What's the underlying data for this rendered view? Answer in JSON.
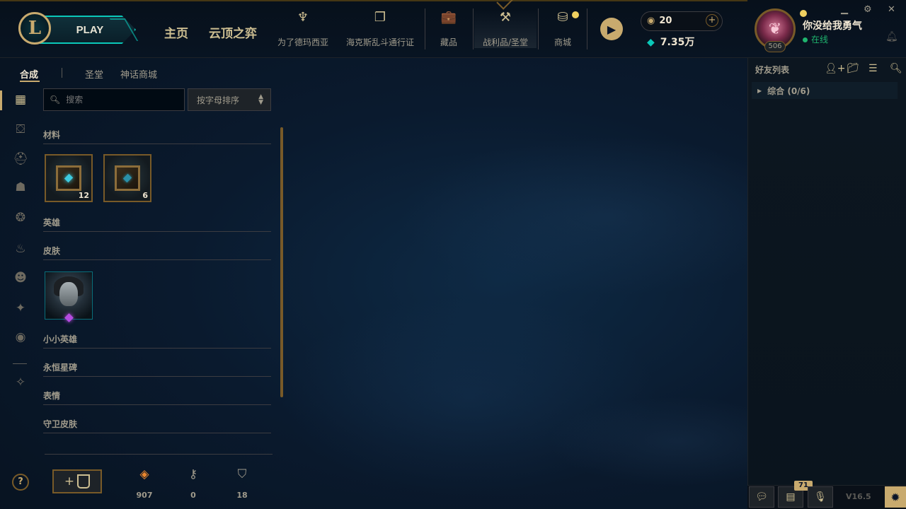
{
  "header": {
    "play_label": "PLAY",
    "main_nav": [
      "主页",
      "云顶之弈"
    ],
    "nav_items": [
      {
        "label": "为了德玛西亚",
        "icon": "trident-icon"
      },
      {
        "label": "海克斯乱斗通行证",
        "icon": "cards-icon"
      },
      {
        "label": "藏品",
        "icon": "briefcase-icon"
      },
      {
        "label": "战利品/圣堂",
        "icon": "loot-icon"
      },
      {
        "label": "商城",
        "icon": "coins-icon"
      }
    ],
    "active_nav": "战利品/圣堂",
    "rp_amount": "20",
    "be_amount": "7.35万",
    "summoner_name": "你没给我勇气",
    "status": "在线",
    "level": "506"
  },
  "subtabs": [
    "合成",
    "圣堂",
    "神话商城"
  ],
  "active_subtab": "合成",
  "search": {
    "placeholder": "搜索"
  },
  "sort": {
    "selected": "按字母排序"
  },
  "categories": {
    "materials": "材料",
    "champions": "英雄",
    "skins": "皮肤",
    "little_legends": "小小英雄",
    "eternals": "永恒星碑",
    "emotes": "表情",
    "ward_skins": "守卫皮肤"
  },
  "material_items": [
    {
      "name": "hextech-chest",
      "count": "12"
    },
    {
      "name": "masterwork-chest",
      "count": "6"
    }
  ],
  "resources": [
    {
      "icon": "orange-essence-icon",
      "value": "907",
      "color": "#e8862e"
    },
    {
      "icon": "key-icon",
      "value": "0",
      "color": "#a09b8c"
    },
    {
      "icon": "chest-icon",
      "value": "18",
      "color": "#a09b8c"
    }
  ],
  "social": {
    "title": "好友列表",
    "group_label": "综合 (0/6)",
    "notification_count": "71",
    "version": "V16.5"
  },
  "colors": {
    "gold": "#c8aa6e",
    "teal": "#0ac8b9",
    "background": "#0a1428"
  }
}
